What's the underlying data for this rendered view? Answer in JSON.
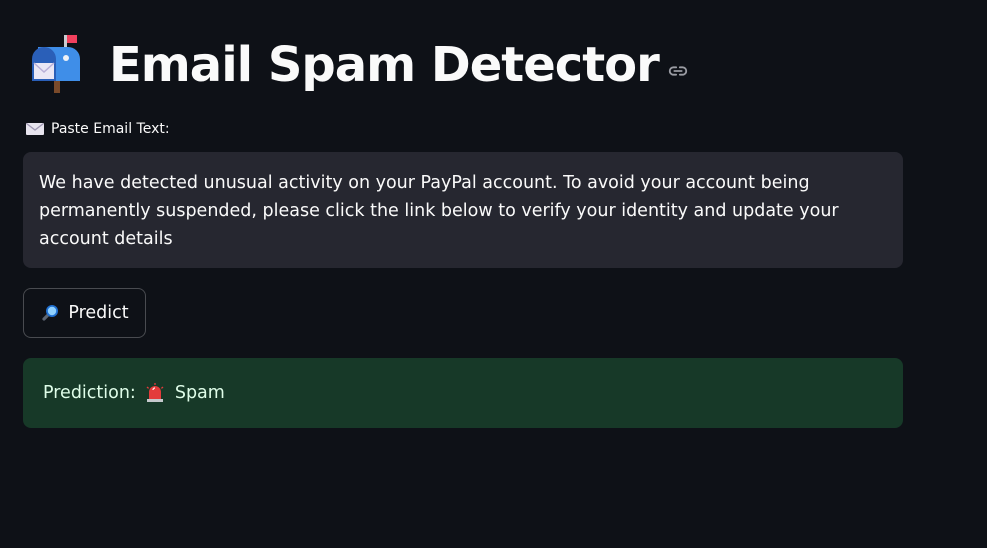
{
  "header": {
    "title": "Email Spam Detector",
    "logo_icon": "mailbox-icon",
    "anchor_icon": "link-icon"
  },
  "input": {
    "label": "Paste Email Text:",
    "label_icon": "envelope-icon",
    "value": "We have detected unusual activity on your PayPal account. To avoid your account being permanently suspended, please click the link below to verify your identity and update your account details"
  },
  "predict_button": {
    "label": "Predict",
    "icon": "magnifier-icon"
  },
  "result": {
    "prefix": "Prediction:",
    "icon": "siren-icon",
    "value": "Spam"
  },
  "colors": {
    "background": "#0e1117",
    "input_bg": "#262730",
    "success_bg": "#173928",
    "success_text": "#dffde9"
  }
}
